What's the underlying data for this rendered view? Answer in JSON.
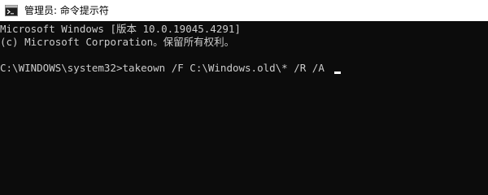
{
  "window": {
    "title": "管理员: 命令提示符",
    "icon": "cmd-icon"
  },
  "console": {
    "lines": [
      "Microsoft Windows [版本 10.0.19045.4291]",
      "(c) Microsoft Corporation。保留所有权利。",
      "",
      "C:\\WINDOWS\\system32>takeown /F C:\\Windows.old\\* /R /A"
    ]
  },
  "colors": {
    "background": "#0c0c0c",
    "text": "#cccccc",
    "titlebar": "#ffffff"
  }
}
